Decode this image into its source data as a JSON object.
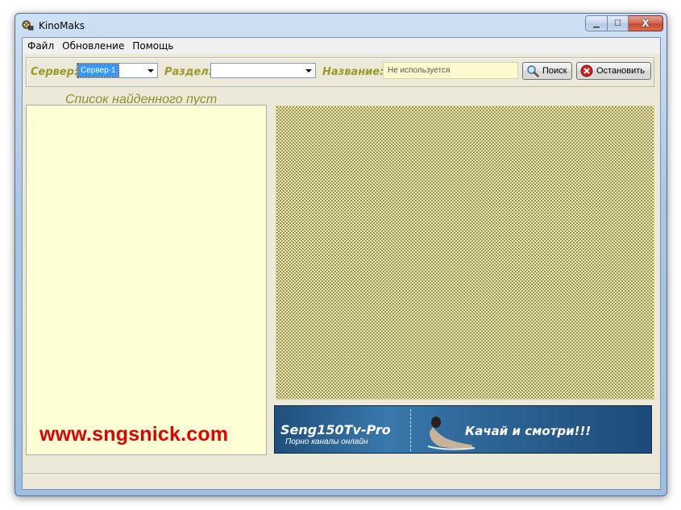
{
  "window": {
    "title": "KinoMaks",
    "app_icon": "film-reel-icon",
    "close_symbol": "X"
  },
  "menu": {
    "items": [
      "Файл",
      "Обновление",
      "Помощь"
    ]
  },
  "toolbar": {
    "server_label": "Сервер:",
    "server_value": "Сервер-1",
    "section_label": "Раздел:",
    "section_value": "",
    "name_label": "Название:",
    "name_value": "Не используется",
    "search_button": "Поиск",
    "stop_button": "Остановить"
  },
  "list": {
    "empty_text": "Список найденного пуст"
  },
  "watermark": {
    "text": "www.sngsnick.com",
    "color": "#e30000"
  },
  "banner": {
    "title": "Seng150Tv-Pro",
    "subtitle": "Порно каналы онлайн",
    "cta": "Качай и смотри!!!"
  },
  "colors": {
    "label": "#9a9a2a",
    "list_bg": "#ffffd6",
    "name_field_bg": "#fffacd",
    "accent_select": "#3399ff"
  }
}
